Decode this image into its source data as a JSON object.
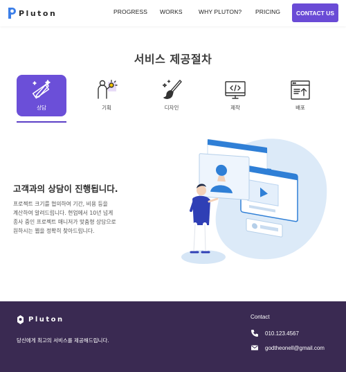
{
  "header": {
    "logo_text": "Pluton",
    "nav": [
      "PROGRESS",
      "WORKS",
      "WHY PLUTON?",
      "PRICING"
    ],
    "cta_label": "CONTACT US"
  },
  "section": {
    "title": "서비스 제공절차",
    "tabs": [
      {
        "label": "상담",
        "icon": "pen-ruler-icon",
        "active": true
      },
      {
        "label": "기획",
        "icon": "planning-person-icon",
        "active": false
      },
      {
        "label": "디자인",
        "icon": "brush-icon",
        "active": false
      },
      {
        "label": "제작",
        "icon": "code-monitor-icon",
        "active": false
      },
      {
        "label": "배포",
        "icon": "upload-document-icon",
        "active": false
      }
    ]
  },
  "content": {
    "title": "고객과의 상담이 진행됩니다.",
    "desc_lines": [
      "프로젝트 크기를 협의하여 기간, 비용 등을",
      "계산하여 알려드립니다. 현업에서 10년 넘게",
      "종사 중인 프로젝트 매니저가 맞춤형 상담으로",
      "원하시는 웹을 정확히 찾아드립니다."
    ]
  },
  "footer": {
    "logo_text": "Pluton",
    "tagline": "당신에게 최고의 서비스를 제공해드립니다.",
    "contact_title": "Contact",
    "phone": "010.123.4567",
    "email": "godtheonell@gmail.com"
  },
  "colors": {
    "accent": "#6a4bd6",
    "footer_bg": "#3a2a52",
    "illustration_blue": "#2f7fd6"
  }
}
